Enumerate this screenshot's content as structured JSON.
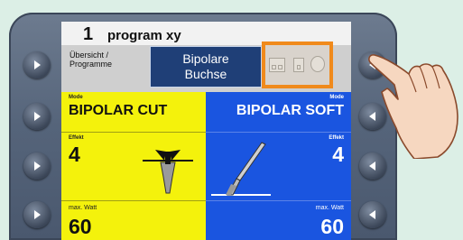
{
  "header": {
    "program_number": "1",
    "program_name": "program xy"
  },
  "info_row": {
    "overview_line1": "Übersicht /",
    "overview_line2": "Programme"
  },
  "popup": {
    "line1": "Bipolare",
    "line2": "Buchse"
  },
  "left_panel": {
    "mode_label": "Mode",
    "mode_value": "BIPOLAR CUT",
    "effect_label": "Effekt",
    "effect_value": "4",
    "watt_label": "max. Watt",
    "watt_value": "60",
    "instrument_icon": "bipolar-forceps-icon"
  },
  "right_panel": {
    "mode_label": "Mode",
    "mode_value": "BIPOLAR SOFT",
    "effect_label": "Effekt",
    "effect_value": "4",
    "watt_label": "max. Watt",
    "watt_value": "60",
    "instrument_icon": "bipolar-instrument-icon"
  },
  "colors": {
    "left_panel": "#f4f20c",
    "right_panel": "#1a55e0",
    "highlight": "#f08a1c",
    "popup": "#1f3f77"
  }
}
